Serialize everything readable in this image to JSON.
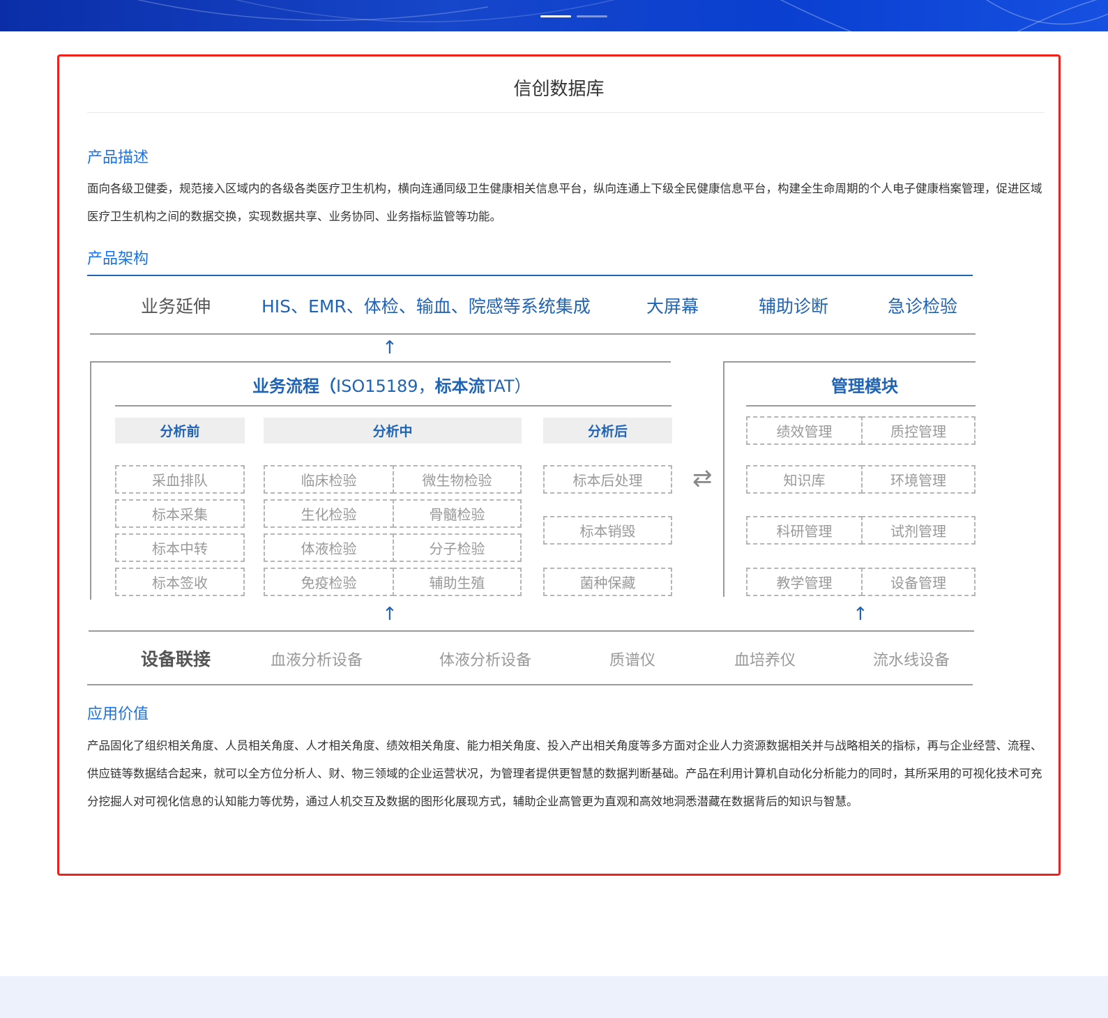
{
  "page": {
    "title": "信创数据库"
  },
  "sections": {
    "description": {
      "heading": "产品描述",
      "text": "面向各级卫健委，规范接入区域内的各级各类医疗卫生机构，横向连通同级卫生健康相关信息平台，纵向连通上下级全民健康信息平台，构建全生命周期的个人电子健康档案管理，促进区域医疗卫生机构之间的数据交换，实现数据共享、业务协同、业务指标监管等功能。"
    },
    "architecture": {
      "heading": "产品架构"
    },
    "value": {
      "heading": "应用价值",
      "text": "产品固化了组织相关角度、人员相关角度、人才相关角度、绩效相关角度、能力相关角度、投入产出相关角度等多方面对企业人力资源数据相关并与战略相关的指标，再与企业经营、流程、供应链等数据结合起来，就可以全方位分析人、财、物三领域的企业运营状况，为管理者提供更智慧的数据判断基础。产品在利用计算机自动化分析能力的同时，其所采用的可视化技术可充分挖掘人对可视化信息的认知能力等优势，通过人机交互及数据的图形化展现方式，辅助企业高管更为直观和高效地洞悉潜藏在数据背后的知识与智慧。"
    }
  },
  "diagram": {
    "extension": {
      "label": "业务延伸",
      "items": [
        "HIS、EMR、体检、输血、院感等系统集成",
        "大屏幕",
        "辅助诊断",
        "急诊检验"
      ]
    },
    "process": {
      "title_cn": "业务流程（",
      "title_code": "ISO15189，",
      "title_cn2": "标本流",
      "title_tat": "TAT）",
      "pre": {
        "header": "分析前",
        "items": [
          "采血排队",
          "标本采集",
          "标本中转",
          "标本签收"
        ]
      },
      "mid": {
        "header": "分析中",
        "items": [
          "临床检验",
          "微生物检验",
          "生化检验",
          "骨髓检验",
          "体液检验",
          "分子检验",
          "免疫检验",
          "辅助生殖"
        ]
      },
      "post": {
        "header": "分析后",
        "items": [
          "标本后处理",
          "标本销毁",
          "菌种保藏"
        ]
      }
    },
    "management": {
      "title": "管理模块",
      "items": [
        "绩效管理",
        "质控管理",
        "知识库",
        "环境管理",
        "科研管理",
        "试剂管理",
        "教学管理",
        "设备管理"
      ]
    },
    "devices": {
      "label": "设备联接",
      "items": [
        "血液分析设备",
        "体液分析设备",
        "质谱仪",
        "血培养仪",
        "流水线设备"
      ]
    },
    "arrows": {
      "up": "↑",
      "exchange": "⇄"
    }
  },
  "banner": {
    "slides_total": 2,
    "active_slide": 1
  }
}
